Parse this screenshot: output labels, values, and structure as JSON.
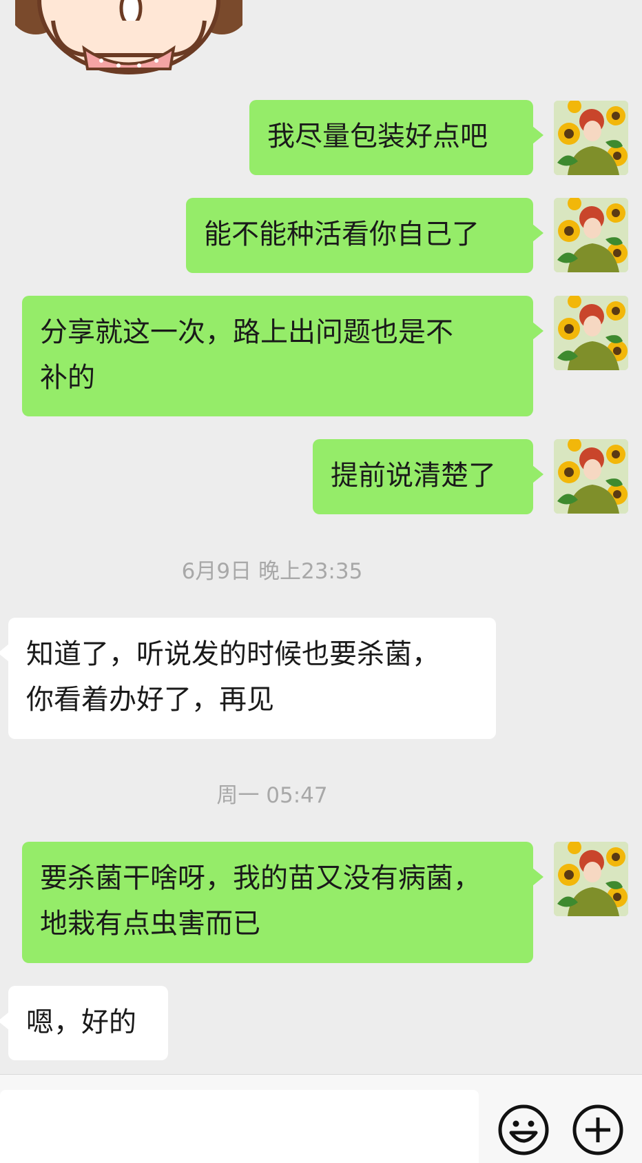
{
  "conversation": {
    "messages": [
      {
        "side": "me",
        "lines": [
          "我尽量包装好点吧"
        ]
      },
      {
        "side": "me",
        "lines": [
          "能不能种活看你自己了"
        ]
      },
      {
        "side": "me",
        "lines": [
          "分享就这一次，路上出问题也是不",
          "补的"
        ]
      },
      {
        "side": "me",
        "lines": [
          "提前说清楚了"
        ]
      },
      {
        "side": "timestamp",
        "text": "6月9日 晚上23:35"
      },
      {
        "side": "them",
        "lines": [
          "知道了，听说发的时候也要杀菌，",
          "你看着办好了，再见"
        ]
      },
      {
        "side": "timestamp",
        "text": "周一 05:47"
      },
      {
        "side": "me",
        "lines": [
          "要杀菌干啥呀，我的苗又没有病菌，",
          "地栽有点虫害而已"
        ]
      },
      {
        "side": "them",
        "lines": [
          "嗯，好的"
        ]
      }
    ]
  },
  "input_bar": {
    "value": "",
    "emoji_icon": "smiley-icon",
    "more_icon": "plus-icon"
  },
  "colors": {
    "background": "#ededed",
    "my_bubble": "#95ec69",
    "their_bubble": "#ffffff",
    "timestamp_text": "#a8a8a8"
  }
}
